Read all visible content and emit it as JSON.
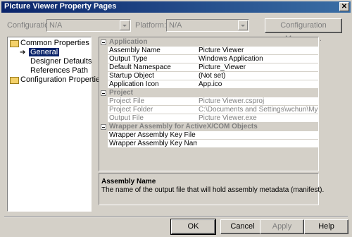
{
  "window": {
    "title": "Picture Viewer Property Pages",
    "close_glyph": "✕"
  },
  "toolbar": {
    "configuration_label": "Configuration:",
    "configuration_value": "N/A",
    "platform_label": "Platform:",
    "platform_value": "N/A",
    "config_manager_label": "Configuration Manager..."
  },
  "tree": {
    "common": "Common Properties",
    "general": "General",
    "designer": "Designer Defaults",
    "references": "References Path",
    "config": "Configuration Properties"
  },
  "grid": {
    "cat_application": "Application",
    "cat_project": "Project",
    "cat_wrapper": "Wrapper Assembly for ActiveX/COM Objects",
    "rows": [
      {
        "name": "Assembly Name",
        "value": "Picture Viewer"
      },
      {
        "name": "Output Type",
        "value": "Windows Application"
      },
      {
        "name": "Default Namespace",
        "value": "Picture_Viewer"
      },
      {
        "name": "Startup Object",
        "value": "(Not set)"
      },
      {
        "name": "Application Icon",
        "value": "App.ico"
      },
      {
        "name": "Project File",
        "value": "Picture Viewer.csproj"
      },
      {
        "name": "Project Folder",
        "value": "C:\\Documents and Settings\\wchun\\My Docume"
      },
      {
        "name": "Output File",
        "value": "Picture Viewer.exe"
      },
      {
        "name": "Wrapper Assembly Key File",
        "value": ""
      },
      {
        "name": "Wrapper Assembly Key Name",
        "value": ""
      }
    ]
  },
  "description": {
    "title": "Assembly Name",
    "text": "The name of the output file that will hold assembly metadata (manifest)."
  },
  "buttons": {
    "ok": "OK",
    "cancel": "Cancel",
    "apply": "Apply",
    "help": "Help"
  }
}
